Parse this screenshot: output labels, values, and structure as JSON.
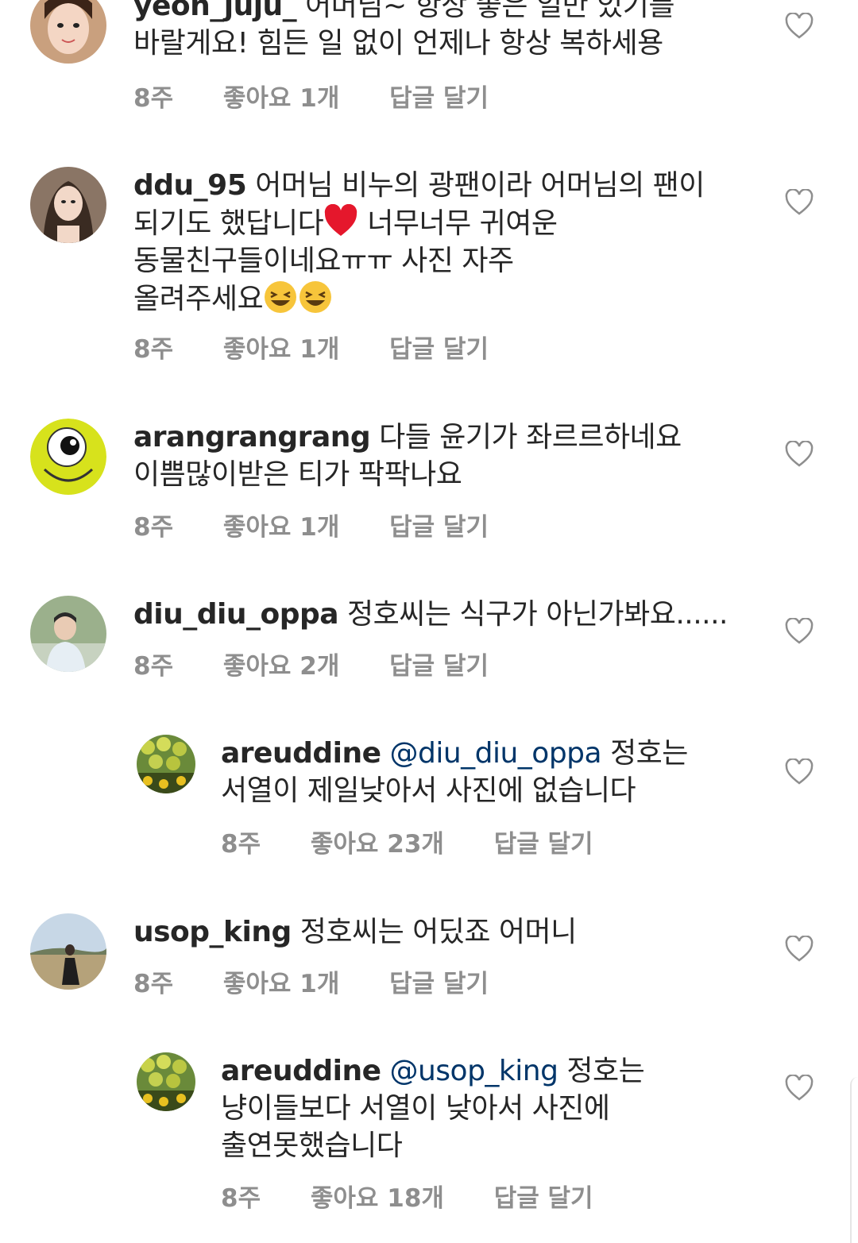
{
  "comments": [
    {
      "username": "yeon_juju_",
      "text_line1": "어머님~ 항상 좋은 일만 있기를",
      "text_line2": "바랄게요! 힘든 일 없이 언제나 항상 복하세용",
      "time": "8주",
      "likes": "좋아요 1개",
      "reply": "답글 달기"
    },
    {
      "username": "ddu_95",
      "text_line1": "어머님 비누의 광팬이라 어머님의 팬이",
      "text_line2a": "되기도 했답니다",
      "text_line2b": "너무너무 귀여운",
      "text_line3": "동물친구들이네요ㅠㅠ 사진 자주",
      "text_line4": "올려주세요",
      "time": "8주",
      "likes": "좋아요 1개",
      "reply": "답글 달기"
    },
    {
      "username": "arangrangrang",
      "text_line1": "다들 윤기가 좌르르하네요",
      "text_line2": "이쁨많이받은 티가 팍팍나요",
      "time": "8주",
      "likes": "좋아요 1개",
      "reply": "답글 달기"
    },
    {
      "username": "diu_diu_oppa",
      "text_line1": "정호씨는 식구가 아닌가봐요......",
      "time": "8주",
      "likes": "좋아요 2개",
      "reply": "답글 달기"
    },
    {
      "username": "areuddine",
      "mention": "@diu_diu_oppa",
      "text_line1": "정호는",
      "text_line2": "서열이 제일낮아서 사진에 없습니다",
      "time": "8주",
      "likes": "좋아요 23개",
      "reply": "답글 달기"
    },
    {
      "username": "usop_king",
      "text_line1": "정호씨는 어딨죠 어머니",
      "time": "8주",
      "likes": "좋아요 1개",
      "reply": "답글 달기"
    },
    {
      "username": "areuddine",
      "mention": "@usop_king",
      "text_line1": "정호는",
      "text_line2": "냥이들보다 서열이 낮아서 사진에",
      "text_line3": "출연못했습니다",
      "time": "8주",
      "likes": "좋아요 18개",
      "reply": "답글 달기"
    }
  ],
  "colors": {
    "text": "#262626",
    "meta": "#8e8e8e",
    "mention": "#003569",
    "heart_outline": "#8e8e8e"
  }
}
